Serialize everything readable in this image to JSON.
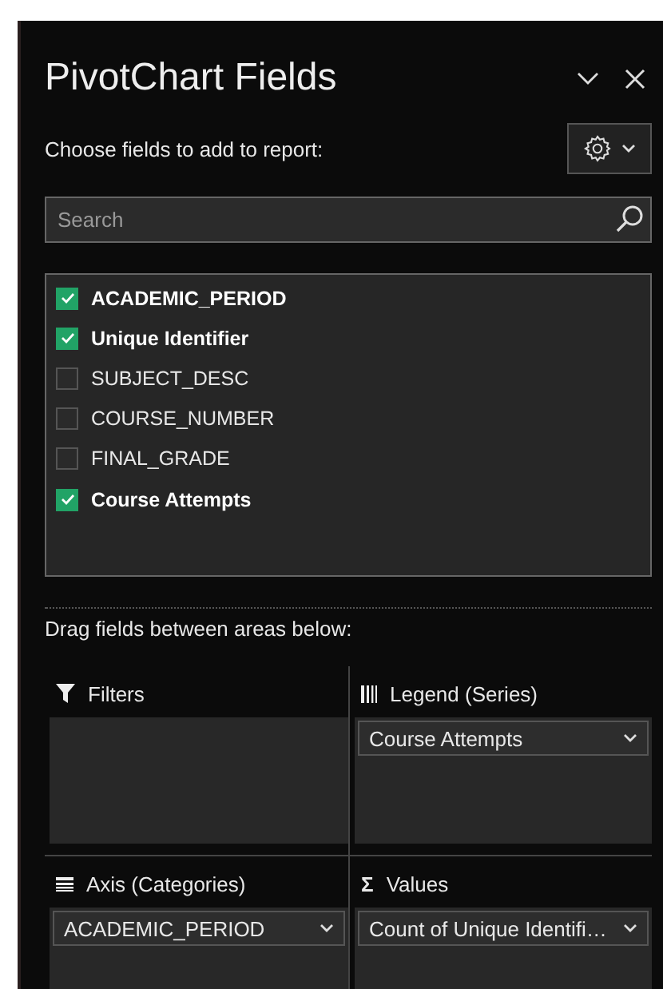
{
  "pane": {
    "title": "PivotChart Fields",
    "subtitle": "Choose fields to add to report:"
  },
  "search": {
    "placeholder": "Search"
  },
  "fields": [
    {
      "label": "ACADEMIC_PERIOD",
      "checked": true
    },
    {
      "label": "Unique Identifier",
      "checked": true
    },
    {
      "label": "SUBJECT_DESC",
      "checked": false
    },
    {
      "label": "COURSE_NUMBER",
      "checked": false
    },
    {
      "label": "FINAL_GRADE",
      "checked": false
    },
    {
      "label": "Course Attempts",
      "checked": true
    }
  ],
  "areas_hint": "Drag fields between areas below:",
  "areas": [
    {
      "kind": "filters",
      "title": "Filters"
    },
    {
      "kind": "legend",
      "title": "Legend (Series)",
      "items": [
        "Course Attempts"
      ]
    },
    {
      "kind": "axis",
      "title": "Axis (Categories)",
      "items": [
        "ACADEMIC_PERIOD"
      ]
    },
    {
      "kind": "values",
      "title": "Values",
      "symbol": "Σ",
      "items": [
        "Count of Unique Identifi…"
      ]
    }
  ]
}
